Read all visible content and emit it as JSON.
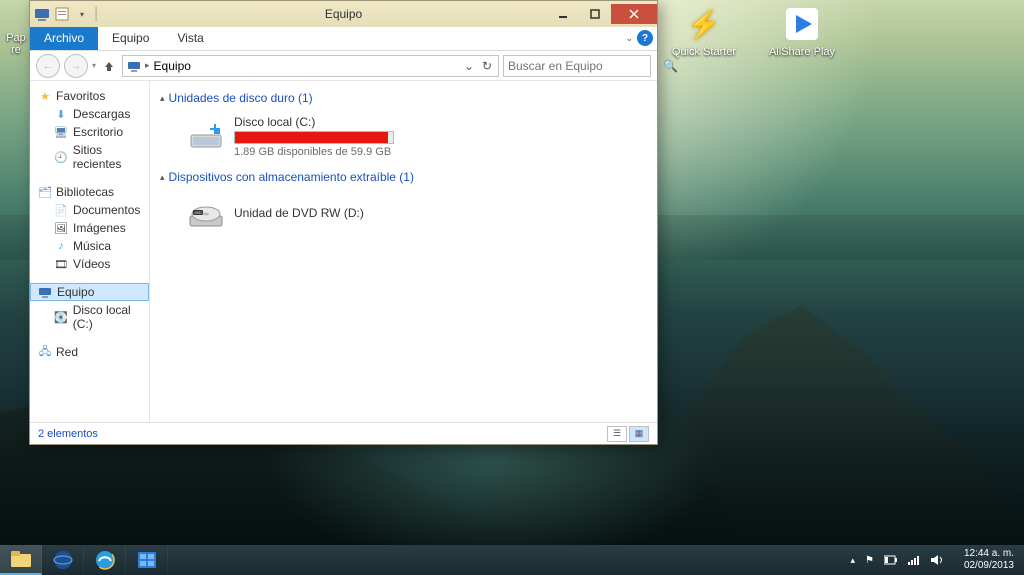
{
  "desktop_partial_label": "Pap\nre",
  "desktop_icons": [
    {
      "label": "Quick Starter",
      "glyph": "⚡",
      "color": "#f2c23a"
    },
    {
      "label": "AllShare Play",
      "glyph": "▶",
      "color": "#2a7de1"
    }
  ],
  "window": {
    "title": "Equipo",
    "ribbon": {
      "file": "Archivo",
      "tabs": [
        "Equipo",
        "Vista"
      ]
    },
    "address": {
      "location": "Equipo",
      "refresh": "↻",
      "dropdown": "⌄"
    },
    "search_placeholder": "Buscar en Equipo",
    "nav_pane": {
      "favorites": {
        "label": "Favoritos",
        "items": [
          {
            "label": "Descargas",
            "glyph": "⬇",
            "color": "#59a0e2"
          },
          {
            "label": "Escritorio",
            "glyph": "🖥",
            "color": "#5a7fb0"
          },
          {
            "label": "Sitios recientes",
            "glyph": "🕘",
            "color": "#7a8aa0"
          }
        ]
      },
      "libraries": {
        "label": "Bibliotecas",
        "items": [
          {
            "label": "Documentos",
            "glyph": "📄",
            "color": "#6aa0d0"
          },
          {
            "label": "Imágenes",
            "glyph": "🖼",
            "color": "#60a8d0"
          },
          {
            "label": "Música",
            "glyph": "♪",
            "color": "#4aa3dd"
          },
          {
            "label": "Vídeos",
            "glyph": "🎞",
            "color": "#6a9cd0"
          }
        ]
      },
      "computer": {
        "label": "Equipo",
        "items": [
          {
            "label": "Disco local (C:)",
            "glyph": "💽",
            "color": "#6090c0"
          }
        ]
      },
      "network": {
        "label": "Red",
        "glyph": "🖧",
        "color": "#4a90d0"
      }
    },
    "content": {
      "hard_drives": {
        "label": "Unidades de disco duro (1)",
        "items": [
          {
            "name": "Disco local (C:)",
            "free_text": "1.89 GB disponibles de 59.9 GB",
            "fill_pct": 97
          }
        ]
      },
      "removable": {
        "label": "Dispositivos con almacenamiento extraíble (1)",
        "items": [
          {
            "name": "Unidad de DVD RW (D:)"
          }
        ]
      }
    },
    "status": "2 elementos"
  },
  "taskbar": {
    "time": "12:44 a. m.",
    "date": "02/09/2013"
  }
}
